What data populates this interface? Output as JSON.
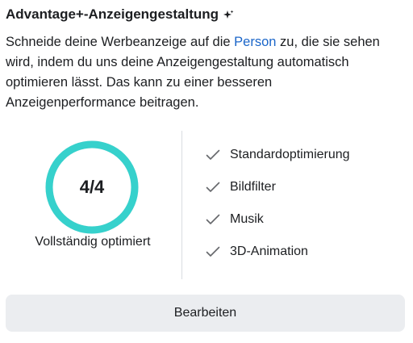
{
  "header": {
    "title": "Advantage+-Anzeigengestaltung",
    "title_icon": "sparkle-icon"
  },
  "description": {
    "before_link": "Schneide deine Werbeanzeige auf die ",
    "link": "Person",
    "after_link": " zu, die sie sehen wird, indem du uns deine Anzeigengestaltung automatisch optimieren lässt. Das kann zu einer besseren Anzeigenperformance beitragen."
  },
  "progress": {
    "score": "4/4",
    "completed": 4,
    "total": 4,
    "status": "Vollständig optimiert",
    "ring_color": "#36d1cc"
  },
  "features": [
    {
      "label": "Standardoptimierung",
      "icon": "checkmark-icon"
    },
    {
      "label": "Bildfilter",
      "icon": "checkmark-icon"
    },
    {
      "label": "Musik",
      "icon": "checkmark-icon"
    },
    {
      "label": "3D-Animation",
      "icon": "checkmark-icon"
    }
  ],
  "actions": {
    "edit_label": "Bearbeiten"
  },
  "colors": {
    "link": "#1b66c9",
    "button_bg": "#ebedf0",
    "text": "#1c1e21"
  }
}
